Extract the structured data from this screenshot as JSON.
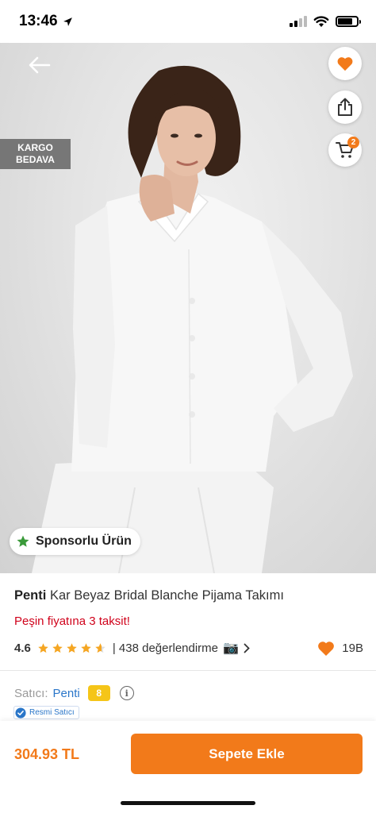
{
  "status_bar": {
    "time": "13:46"
  },
  "hero": {
    "kargo_line1": "KARGO",
    "kargo_line2": "BEDAVA",
    "cart_count": "2",
    "sponsored_label": "Sponsorlu Ürün",
    "image_count": 5,
    "active_image": 4
  },
  "product": {
    "brand": "Penti",
    "name": "Kar Beyaz Bridal Blanche Pijama Takımı",
    "installment_text": "Peşin fiyatına 3 taksit!",
    "rating": "4.6",
    "stars_value": 4.6,
    "reviews_text": "| 438 değerlendirme",
    "favorites_count": "19B"
  },
  "seller": {
    "label": "Satıcı:",
    "name": "Penti",
    "score": "8",
    "official_label": "Resmi Satıcı"
  },
  "bottom": {
    "price": "304.93 TL",
    "add_to_cart_label": "Sepete Ekle"
  },
  "colors": {
    "accent": "#f27a1a",
    "installment_red": "#d0021b",
    "seller_blue": "#2a76c9",
    "score_yellow": "#f5c518",
    "star": "#f5a623",
    "sponsor_star": "#3a9a3a"
  }
}
